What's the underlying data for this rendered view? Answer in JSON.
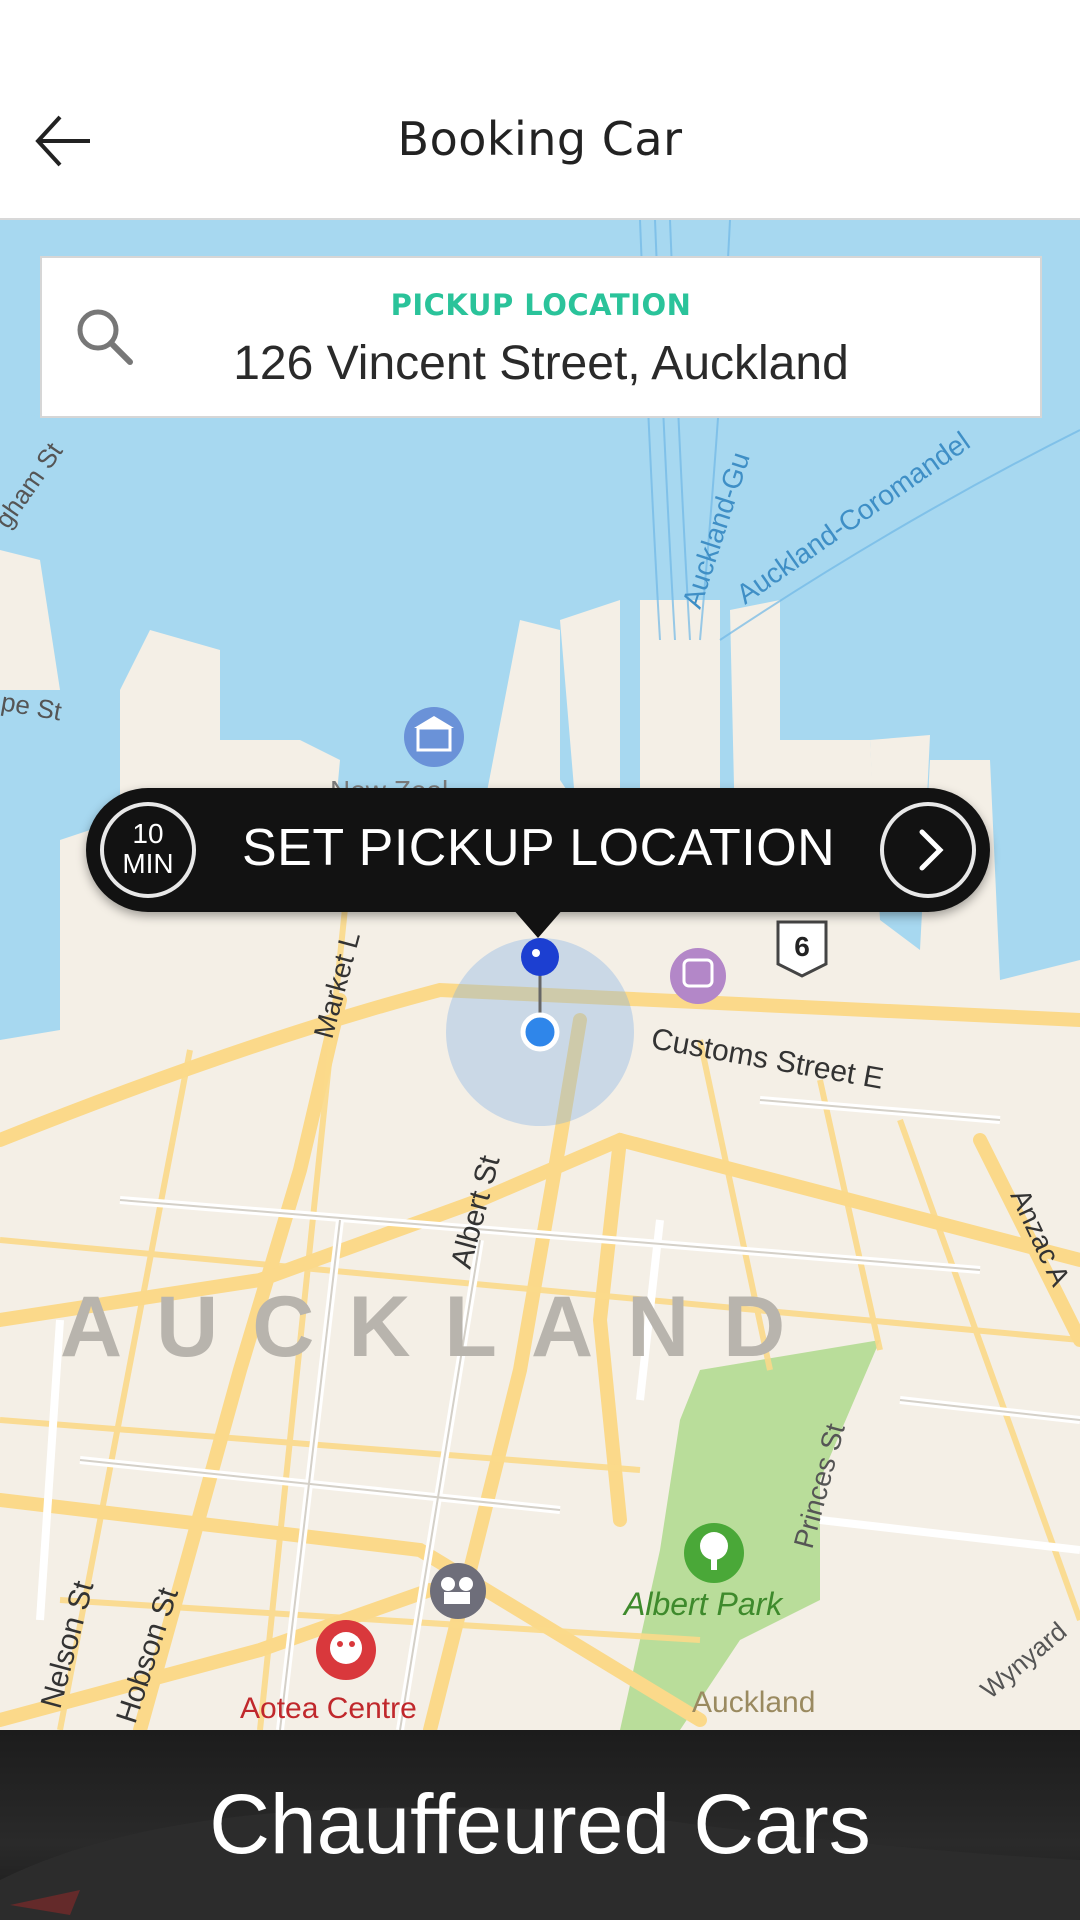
{
  "header": {
    "title": "Booking Car",
    "back_icon": "arrow-left-icon"
  },
  "search": {
    "label": "PICKUP LOCATION",
    "address": "126 Vincent Street, Auckland",
    "icon": "search-icon"
  },
  "callout": {
    "eta_value": "10",
    "eta_unit": "MIN",
    "action_label": "SET PICKUP LOCATION",
    "go_icon": "chevron-right-icon"
  },
  "map": {
    "city_label": "AUCKLAND",
    "streets": {
      "customs": "Customs Street E",
      "albert": "Albert St",
      "market": "Market L",
      "nelson": "Nelson St",
      "hobson": "Hobson St",
      "princes": "Princes St",
      "anzac": "Anzac A",
      "wynyard": "Wynyard",
      "gham": "gham St",
      "pe": "pe St",
      "ferry_1": "Auckland-Gu",
      "ferry_2": "Auckland-Coromandel"
    },
    "pois": {
      "park": "Albert Park",
      "theatre": "Aotea Centre",
      "university": "Auckland",
      "museum_partial": "New Zeal"
    },
    "highway_shield": "6",
    "colors": {
      "water": "#a7d8f0",
      "land": "#f4efe6",
      "road": "#fbd98a",
      "park": "#b9dd9a",
      "pin": "#1c3fd1",
      "location": "#2f86ea"
    }
  },
  "footer": {
    "title": "Chauffeured Cars"
  }
}
